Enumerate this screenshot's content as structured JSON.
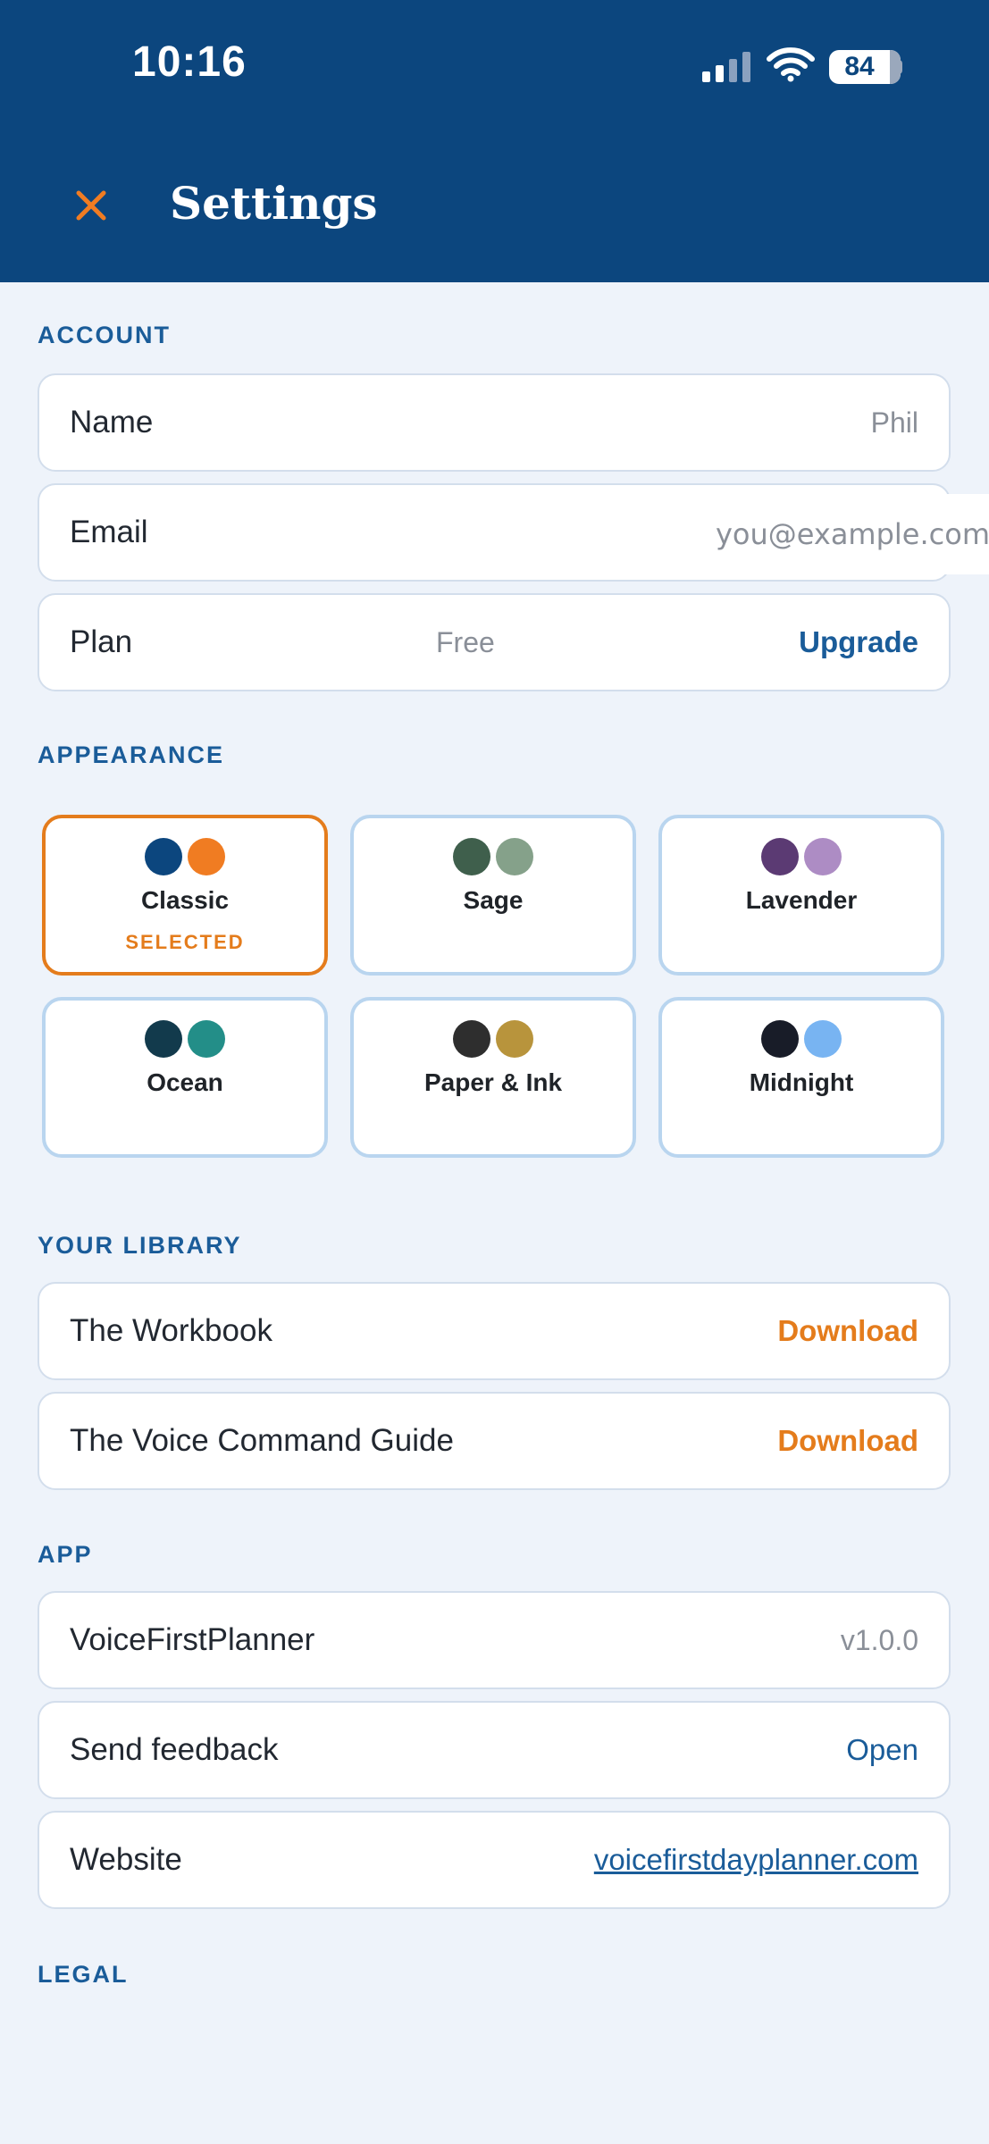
{
  "status_bar": {
    "time": "10:16",
    "battery": "84"
  },
  "header": {
    "title": "Settings"
  },
  "account": {
    "label": "ACCOUNT",
    "name_label": "Name",
    "name_value": "Phil",
    "email_label": "Email",
    "email_placeholder": "you@example.com",
    "plan_label": "Plan",
    "plan_value": "Free",
    "plan_action": "Upgrade"
  },
  "appearance": {
    "label": "APPEARANCE",
    "selected_text": "SELECTED",
    "themes": [
      {
        "name": "Classic",
        "colors": [
          "#0c467e",
          "#f07c22"
        ],
        "selected": true
      },
      {
        "name": "Sage",
        "colors": [
          "#3f5f4c",
          "#85a18a"
        ],
        "selected": false
      },
      {
        "name": "Lavender",
        "colors": [
          "#5b3a73",
          "#ad8cc4"
        ],
        "selected": false
      },
      {
        "name": "Ocean",
        "colors": [
          "#123a4c",
          "#238e88"
        ],
        "selected": false
      },
      {
        "name": "Paper & Ink",
        "colors": [
          "#2e2e2e",
          "#b8943c"
        ],
        "selected": false
      },
      {
        "name": "Midnight",
        "colors": [
          "#181c28",
          "#78b4f2"
        ],
        "selected": false
      }
    ]
  },
  "library": {
    "label": "YOUR LIBRARY",
    "items": [
      {
        "title": "The Workbook",
        "action": "Download"
      },
      {
        "title": "The Voice Command Guide",
        "action": "Download"
      }
    ]
  },
  "app": {
    "label": "APP",
    "name_label": "VoiceFirstPlanner",
    "version": "v1.0.0",
    "feedback_label": "Send feedback",
    "feedback_action": "Open",
    "website_label": "Website",
    "website_link": "voicefirstdayplanner.com"
  },
  "legal": {
    "label": "LEGAL"
  },
  "colors": {
    "header": "#0c467e",
    "accent": "#e47c1c",
    "link": "#1a5c99",
    "background": "#eef3fa"
  }
}
